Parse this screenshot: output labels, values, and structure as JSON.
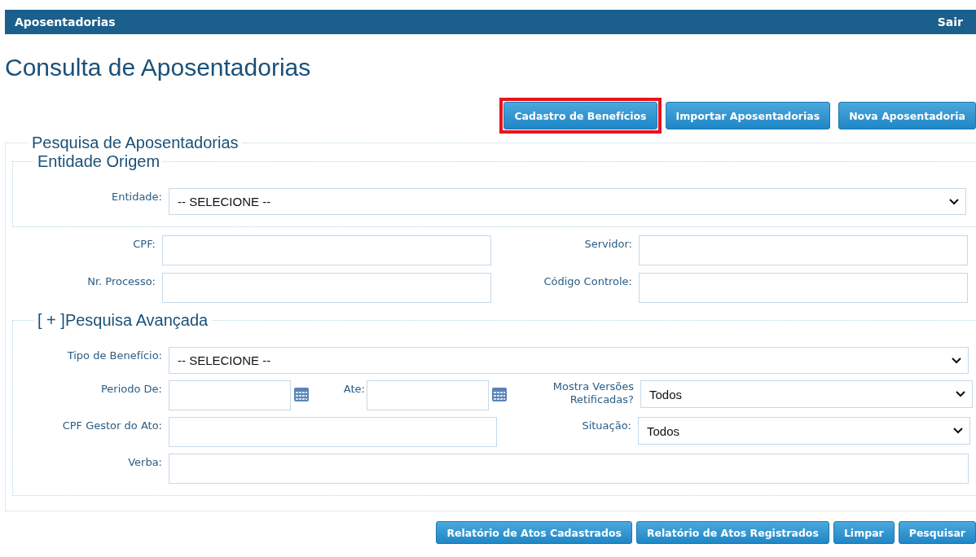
{
  "header": {
    "title": "Aposentadorias",
    "logout": "Sair"
  },
  "page_title": "Consulta de Aposentadorias",
  "top_buttons": [
    {
      "label": "Cadastro de Benefícios",
      "highlighted": true
    },
    {
      "label": "Importar Aposentadorias",
      "highlighted": false
    },
    {
      "label": "Nova Aposentadoria",
      "highlighted": false
    }
  ],
  "search": {
    "legend": "Pesquisa de Aposentadorias",
    "origin": {
      "legend": "Entidade Origem",
      "entity": {
        "label": "Entidade:",
        "value": "-- SELECIONE --"
      }
    },
    "basic_fields": [
      {
        "label": "CPF:"
      },
      {
        "label": "Servidor:"
      },
      {
        "label": "Nr. Processo:"
      },
      {
        "label": "Código Controle:"
      }
    ],
    "advanced": {
      "legend": "[ + ]Pesquisa Avançada",
      "benefit_type": {
        "label": "Tipo de Benefício:",
        "value": "-- SELECIONE --"
      },
      "period_from": {
        "label": "Periodo De:"
      },
      "period_to": {
        "label": "Ate:"
      },
      "revised_versions": {
        "label": "Mostra Versões Retificadas?",
        "value": "Todos"
      },
      "manager_cpf": {
        "label": "CPF Gestor do Ato:"
      },
      "status": {
        "label": "Situação:",
        "value": "Todos"
      },
      "budget": {
        "label": "Verba:"
      }
    }
  },
  "bottom_buttons": [
    {
      "label": "Relatório de Atos Cadastrados"
    },
    {
      "label": "Relatório de Atos Registrados"
    },
    {
      "label": "Limpar"
    },
    {
      "label": "Pesquisar"
    }
  ]
}
